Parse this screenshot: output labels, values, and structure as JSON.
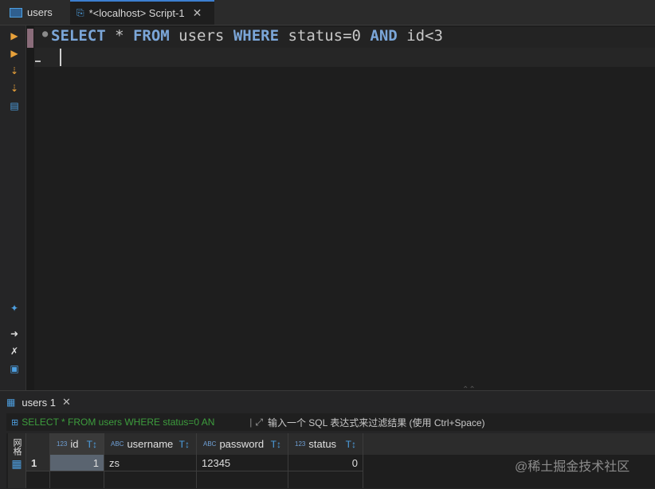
{
  "tabs": [
    {
      "label": "users",
      "icon": "table-icon"
    },
    {
      "label": "*<localhost> Script-1",
      "icon": "script-icon",
      "close": "✕"
    }
  ],
  "editor": {
    "line1": [
      {
        "t": "SELECT",
        "k": true
      },
      {
        "t": " * ",
        "k": false
      },
      {
        "t": "FROM",
        "k": true
      },
      {
        "t": " users ",
        "k": false
      },
      {
        "t": "WHERE",
        "k": true
      },
      {
        "t": " status=0 ",
        "k": false
      },
      {
        "t": "AND",
        "k": true
      },
      {
        "t": " id<3",
        "k": false
      }
    ]
  },
  "results": {
    "tab_label": "users 1",
    "tab_close": "✕",
    "filter_sql": "SELECT * FROM users WHERE status=0 AN",
    "filter_placeholder": "输入一个 SQL 表达式来过滤结果 (使用 Ctrl+Space)",
    "side_label": "网格",
    "columns": [
      {
        "type": "123",
        "name": "id"
      },
      {
        "type": "ABC",
        "name": "username"
      },
      {
        "type": "ABC",
        "name": "password"
      },
      {
        "type": "123",
        "name": "status"
      }
    ],
    "rows": [
      {
        "num": "1",
        "cells": [
          "1",
          "zs",
          "12345",
          "0"
        ]
      }
    ]
  },
  "watermark": "@稀土掘金技术社区",
  "colors": {
    "keyword": "#7ba6d8",
    "sql_preview": "#3d9d3d",
    "accent": "#3c7fd1"
  }
}
